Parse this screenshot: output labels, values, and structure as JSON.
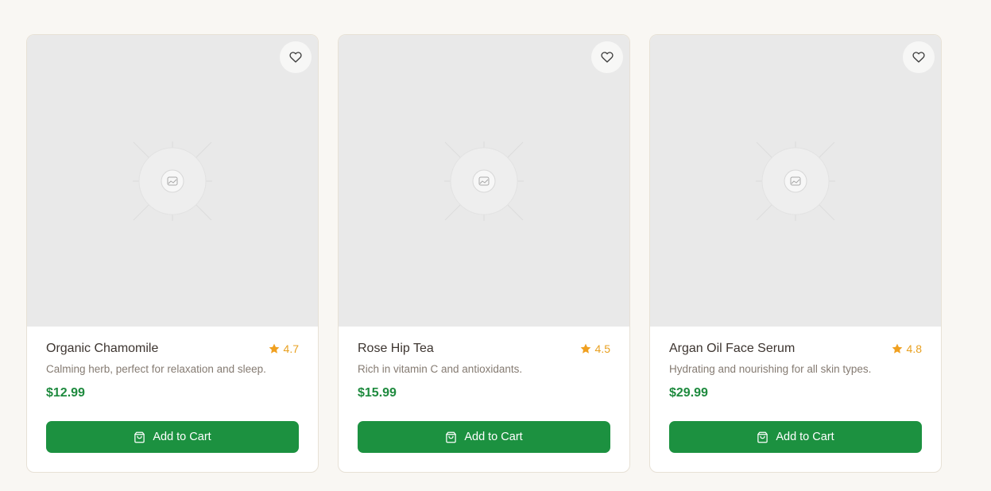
{
  "colors": {
    "accent": "#1c9140",
    "price": "#1e8a3e",
    "rating": "#e8a020",
    "page_bg": "#f9f7f3"
  },
  "products": [
    {
      "name": "Organic Chamomile",
      "rating": "4.7",
      "description": "Calming herb, perfect for relaxation and sleep.",
      "price": "$12.99",
      "button_label": "Add to Cart",
      "icons": [
        "heart-icon",
        "star-icon",
        "image-placeholder-icon",
        "shopping-bag-icon"
      ]
    },
    {
      "name": "Rose Hip Tea",
      "rating": "4.5",
      "description": "Rich in vitamin C and antioxidants.",
      "price": "$15.99",
      "button_label": "Add to Cart",
      "icons": [
        "heart-icon",
        "star-icon",
        "image-placeholder-icon",
        "shopping-bag-icon"
      ]
    },
    {
      "name": "Argan Oil Face Serum",
      "rating": "4.8",
      "description": "Hydrating and nourishing for all skin types.",
      "price": "$29.99",
      "button_label": "Add to Cart",
      "icons": [
        "heart-icon",
        "star-icon",
        "image-placeholder-icon",
        "shopping-bag-icon"
      ]
    }
  ]
}
